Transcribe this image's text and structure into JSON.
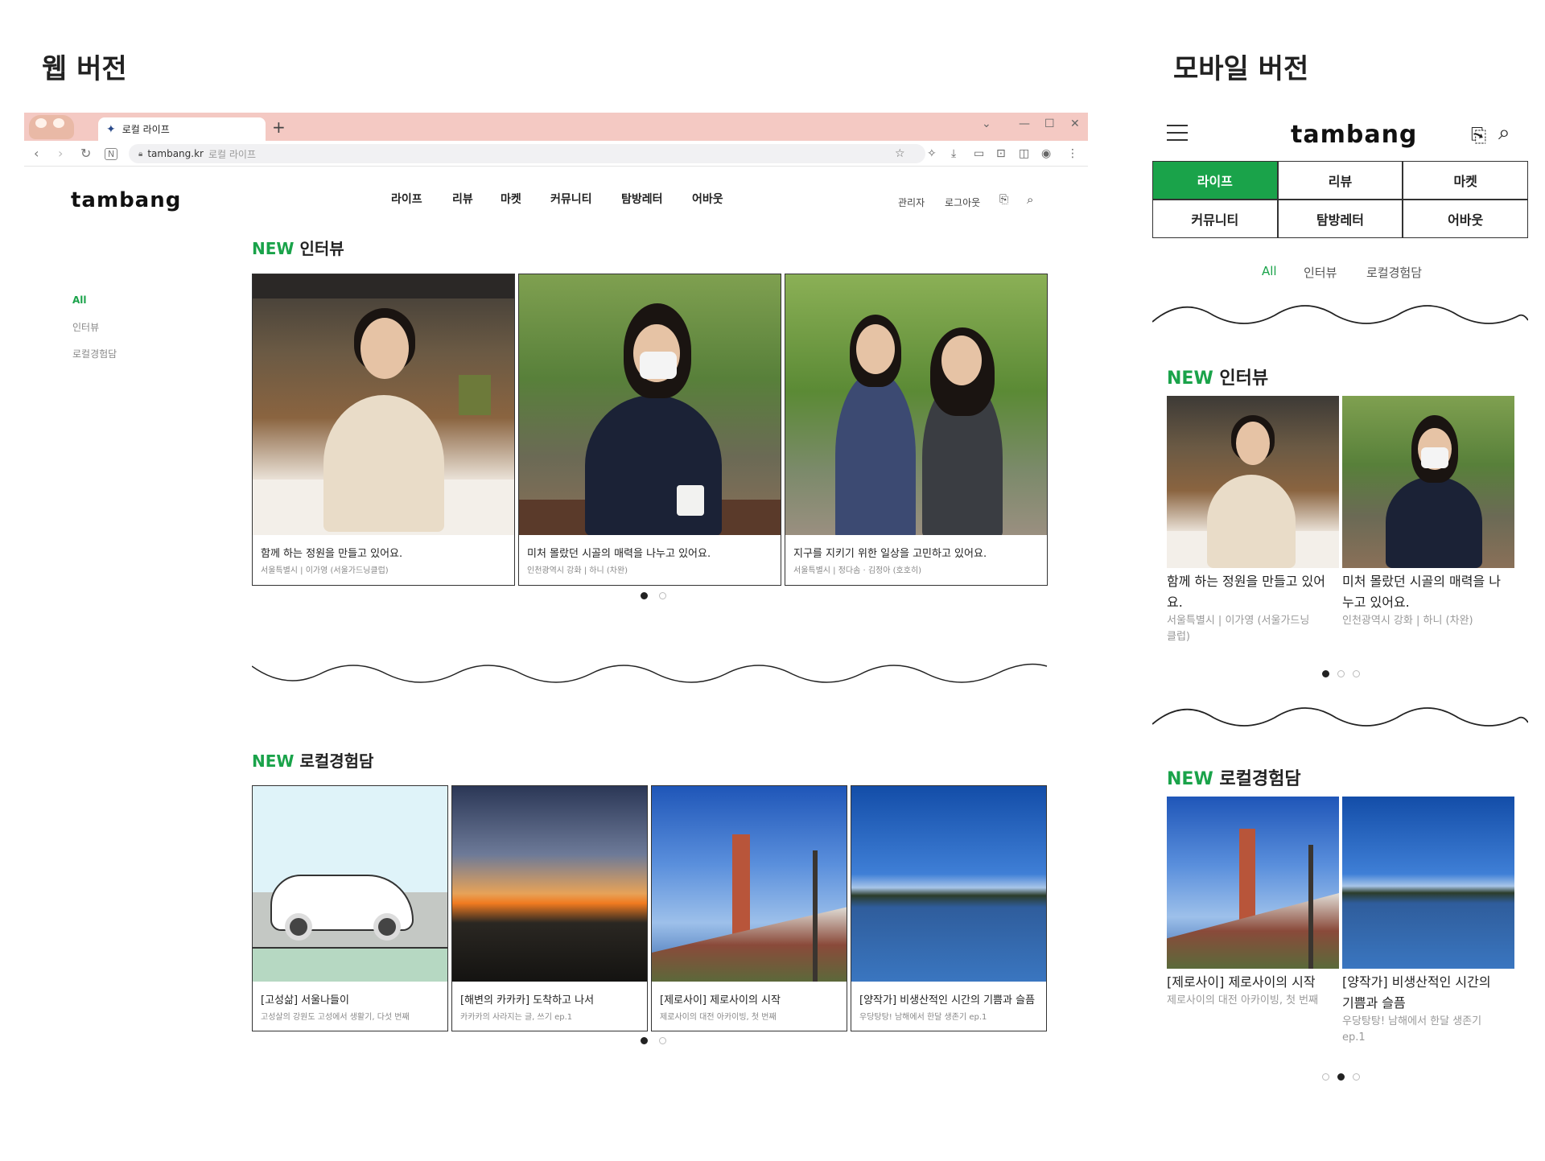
{
  "labels": {
    "web_version": "웹 버전",
    "mobile_version": "모바일 버전"
  },
  "browser": {
    "tab_title": "로컬 라이프",
    "new_tab": "+",
    "url_domain": "tambang.kr",
    "url_title": "로컬 라이프",
    "window_controls": [
      "⌄",
      "—",
      "☐",
      "✕"
    ]
  },
  "site": {
    "logo": "tambang",
    "menu": [
      "라이프",
      "리뷰",
      "마켓",
      "커뮤니티",
      "탐방레터",
      "어바웃"
    ],
    "util": {
      "admin": "관리자",
      "logout": "로그아웃"
    },
    "filters": [
      "All",
      "인터뷰",
      "로컬경험담"
    ],
    "interview_section": {
      "new": "NEW",
      "label": "인터뷰"
    },
    "local_section": {
      "new": "NEW",
      "label": "로컬경험담"
    },
    "interviews": [
      {
        "title": "함께 하는 정원을 만들고 있어요.",
        "sub": "서울특별시 | 이가영 (서울가드닝클럽)"
      },
      {
        "title": "미처 몰랐던 시골의 매력을 나누고 있어요.",
        "sub": "인천광역시 강화 | 하니 (차완)"
      },
      {
        "title": "지구를 지키기 위한 일상을 고민하고 있어요.",
        "sub": "서울특별시 | 정다솜 · 김정아 (호호히)"
      }
    ],
    "locals": [
      {
        "title": "[고성삶] 서울나들이",
        "sub": "고성살의 강원도 고성에서 생활기, 다섯 번째"
      },
      {
        "title": "[해변의 카카카] 도착하고 나서",
        "sub": "카카카의 사라지는 글, 쓰기 ep.1"
      },
      {
        "title": "[제로사이] 제로사이의 시작",
        "sub": "제로사이의 대전 아카이빙, 첫 번째"
      },
      {
        "title": "[양작가] 비생산적인 시간의 기쁨과 슬픔",
        "sub": "우당탕탕! 남해에서 한달 생존기 ep.1"
      }
    ]
  },
  "mobile": {
    "logo": "tambang",
    "menu": [
      "라이프",
      "리뷰",
      "마켓",
      "커뮤니티",
      "탐방레터",
      "어바웃"
    ],
    "filters": [
      "All",
      "인터뷰",
      "로컬경험담"
    ],
    "interviews": [
      {
        "title_l1": "함께 하는 정원을 만들고 있어",
        "title_l2": "요.",
        "sub_l1": "서울특별시 | 이가영 (서울가드닝",
        "sub_l2": "클럽)"
      },
      {
        "title_l1": "미처 몰랐던 시골의 매력을 나",
        "title_l2": "누고 있어요.",
        "sub_l1": "인천광역시 강화 | 하니 (차완)",
        "sub_l2": ""
      }
    ],
    "locals": [
      {
        "title_l1": "[제로사이] 제로사이의 시작",
        "title_l2": "",
        "sub_l1": "제로사이의 대전 아카이빙, 첫 번째",
        "sub_l2": ""
      },
      {
        "title_l1": "[양작가] 비생산적인 시간의",
        "title_l2": "기쁨과 슬픔",
        "sub_l1": "우당탕탕! 남해에서 한달 생존기",
        "sub_l2": "ep.1"
      }
    ]
  },
  "colors": {
    "accent_green": "#1aa34a",
    "tab_bar_pink": "#f4c9c3"
  }
}
